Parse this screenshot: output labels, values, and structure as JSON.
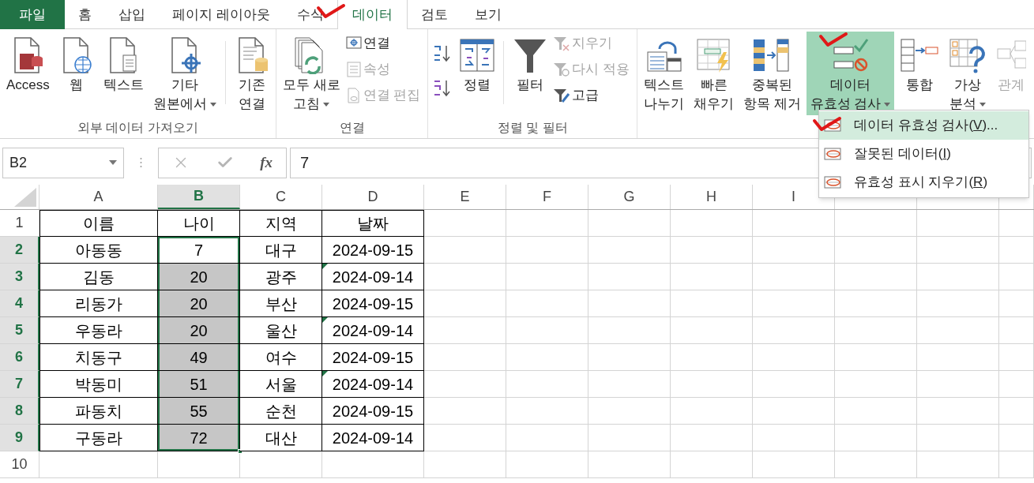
{
  "tabs": [
    {
      "label": "파일",
      "kind": "file",
      "selected": false
    },
    {
      "label": "홈",
      "kind": "tab",
      "selected": false
    },
    {
      "label": "삽입",
      "kind": "tab",
      "selected": false
    },
    {
      "label": "페이지 레이아웃",
      "kind": "tab",
      "selected": false
    },
    {
      "label": "수식",
      "kind": "tab",
      "selected": false
    },
    {
      "label": "데이터",
      "kind": "tab",
      "selected": true
    },
    {
      "label": "검토",
      "kind": "tab",
      "selected": false
    },
    {
      "label": "보기",
      "kind": "tab",
      "selected": false
    }
  ],
  "ribbon": {
    "groups": [
      {
        "label": "외부 데이터 가져오기",
        "items": [
          {
            "kind": "large",
            "lines": [
              "Access"
            ],
            "dropdown": false,
            "disabled": false,
            "pressed": false
          },
          {
            "kind": "large",
            "lines": [
              "웹"
            ],
            "dropdown": false,
            "disabled": false,
            "pressed": false
          },
          {
            "kind": "large",
            "lines": [
              "텍스트"
            ],
            "dropdown": false,
            "disabled": false,
            "pressed": false
          },
          {
            "kind": "large",
            "lines": [
              "기타",
              "원본에서"
            ],
            "dropdown": true,
            "disabled": false,
            "pressed": false
          },
          {
            "kind": "separator"
          },
          {
            "kind": "large",
            "lines": [
              "기존",
              "연결"
            ],
            "dropdown": false,
            "disabled": false,
            "pressed": false
          }
        ]
      },
      {
        "label": "연결",
        "items": [
          {
            "kind": "large",
            "lines": [
              "모두 새로",
              "고침"
            ],
            "dropdown": true,
            "disabled": false,
            "pressed": false
          },
          {
            "kind": "stack",
            "children": [
              {
                "label": "연결",
                "disabled": false
              },
              {
                "label": "속성",
                "disabled": true
              },
              {
                "label": "연결 편집",
                "disabled": true
              }
            ]
          }
        ]
      },
      {
        "label": "정렬 및 필터",
        "items": [
          {
            "kind": "sort"
          },
          {
            "kind": "large",
            "lines": [
              "정렬"
            ],
            "dropdown": false,
            "disabled": false,
            "pressed": false
          },
          {
            "kind": "separator"
          },
          {
            "kind": "large",
            "lines": [
              "필터"
            ],
            "dropdown": false,
            "disabled": false,
            "pressed": false
          },
          {
            "kind": "stack",
            "children": [
              {
                "label": "지우기",
                "disabled": true
              },
              {
                "label": "다시 적용",
                "disabled": true
              },
              {
                "label": "고급",
                "disabled": false
              }
            ]
          }
        ]
      },
      {
        "items": [
          {
            "kind": "large",
            "lines": [
              "텍스트",
              "나누기"
            ],
            "dropdown": false,
            "disabled": false,
            "pressed": false
          },
          {
            "kind": "large",
            "lines": [
              "빠른",
              "채우기"
            ],
            "dropdown": false,
            "disabled": false,
            "pressed": false
          },
          {
            "kind": "large",
            "lines": [
              "중복된",
              "항목 제거"
            ],
            "dropdown": false,
            "disabled": false,
            "pressed": false
          },
          {
            "kind": "large",
            "lines": [
              "데이터",
              "유효성 검사"
            ],
            "dropdown": true,
            "disabled": false,
            "pressed": true
          },
          {
            "kind": "large",
            "lines": [
              "통합"
            ],
            "dropdown": false,
            "disabled": false,
            "pressed": false
          },
          {
            "kind": "large",
            "lines": [
              "가상",
              "분석"
            ],
            "dropdown": true,
            "disabled": false,
            "pressed": false
          },
          {
            "kind": "large",
            "lines": [
              "관계"
            ],
            "dropdown": false,
            "disabled": true,
            "pressed": false
          }
        ]
      }
    ]
  },
  "formula_bar": {
    "name_box": "B2",
    "fx_label": "fx",
    "value": "7"
  },
  "columns": [
    {
      "label": "A",
      "selected": false
    },
    {
      "label": "B",
      "selected": true
    },
    {
      "label": "C",
      "selected": false
    },
    {
      "label": "D",
      "selected": false
    },
    {
      "label": "E",
      "selected": false
    },
    {
      "label": "F",
      "selected": false
    },
    {
      "label": "G",
      "selected": false
    },
    {
      "label": "H",
      "selected": false
    },
    {
      "label": "I",
      "selected": false
    },
    {
      "selected": false
    },
    {
      "selected": false
    },
    {
      "selected": false
    }
  ],
  "rows": [
    {
      "number": "1",
      "selected": false,
      "cells": [
        {
          "text": "이름",
          "selected": false,
          "flag": false
        },
        {
          "text": "나이",
          "selected": false,
          "flag": false
        },
        {
          "text": "지역",
          "selected": false,
          "flag": false
        },
        {
          "text": "날짜",
          "selected": false,
          "flag": false
        }
      ]
    },
    {
      "number": "2",
      "selected": true,
      "cells": [
        {
          "text": "아동동",
          "selected": false,
          "flag": false
        },
        {
          "text": "7",
          "selected": true,
          "active": true,
          "flag": false
        },
        {
          "text": "대구",
          "selected": false,
          "flag": false
        },
        {
          "text": "2024-09-15",
          "selected": false,
          "flag": false
        }
      ]
    },
    {
      "number": "3",
      "selected": true,
      "cells": [
        {
          "text": "김동",
          "selected": false,
          "flag": false
        },
        {
          "text": "20",
          "selected": true,
          "active": false,
          "flag": false
        },
        {
          "text": "광주",
          "selected": false,
          "flag": false
        },
        {
          "text": "2024-09-14",
          "selected": false,
          "flag": true
        }
      ]
    },
    {
      "number": "4",
      "selected": true,
      "cells": [
        {
          "text": "리동가",
          "selected": false,
          "flag": false
        },
        {
          "text": "20",
          "selected": true,
          "active": false,
          "flag": false
        },
        {
          "text": "부산",
          "selected": false,
          "flag": false
        },
        {
          "text": "2024-09-15",
          "selected": false,
          "flag": false
        }
      ]
    },
    {
      "number": "5",
      "selected": true,
      "cells": [
        {
          "text": "우동라",
          "selected": false,
          "flag": false
        },
        {
          "text": "20",
          "selected": true,
          "active": false,
          "flag": false
        },
        {
          "text": "울산",
          "selected": false,
          "flag": false
        },
        {
          "text": "2024-09-14",
          "selected": false,
          "flag": true
        }
      ]
    },
    {
      "number": "6",
      "selected": true,
      "cells": [
        {
          "text": "치동구",
          "selected": false,
          "flag": false
        },
        {
          "text": "49",
          "selected": true,
          "active": false,
          "flag": false
        },
        {
          "text": "여수",
          "selected": false,
          "flag": false
        },
        {
          "text": "2024-09-15",
          "selected": false,
          "flag": false
        }
      ]
    },
    {
      "number": "7",
      "selected": true,
      "cells": [
        {
          "text": "박동미",
          "selected": false,
          "flag": false
        },
        {
          "text": "51",
          "selected": true,
          "active": false,
          "flag": false
        },
        {
          "text": "서울",
          "selected": false,
          "flag": false
        },
        {
          "text": "2024-09-14",
          "selected": false,
          "flag": true
        }
      ]
    },
    {
      "number": "8",
      "selected": true,
      "cells": [
        {
          "text": "파동치",
          "selected": false,
          "flag": false
        },
        {
          "text": "55",
          "selected": true,
          "active": false,
          "flag": false
        },
        {
          "text": "순천",
          "selected": false,
          "flag": false
        },
        {
          "text": "2024-09-15",
          "selected": false,
          "flag": false
        }
      ]
    },
    {
      "number": "9",
      "selected": true,
      "cells": [
        {
          "text": "구동라",
          "selected": false,
          "flag": false
        },
        {
          "text": "72",
          "selected": true,
          "active": false,
          "flag": false
        },
        {
          "text": "대산",
          "selected": false,
          "flag": false
        },
        {
          "text": "2024-09-14",
          "selected": false,
          "flag": false
        }
      ]
    },
    {
      "number": "10",
      "selected": false,
      "cells": []
    }
  ],
  "menu": {
    "items": [
      {
        "before": "데이터 유효성 검사(",
        "key": "V",
        "after": ")...",
        "selected": true
      },
      {
        "before": "잘못된 데이터(",
        "key": "I",
        "after": ")",
        "selected": false
      },
      {
        "before": "유효성 표시 지우기(",
        "key": "R",
        "after": ")",
        "selected": false
      }
    ]
  }
}
